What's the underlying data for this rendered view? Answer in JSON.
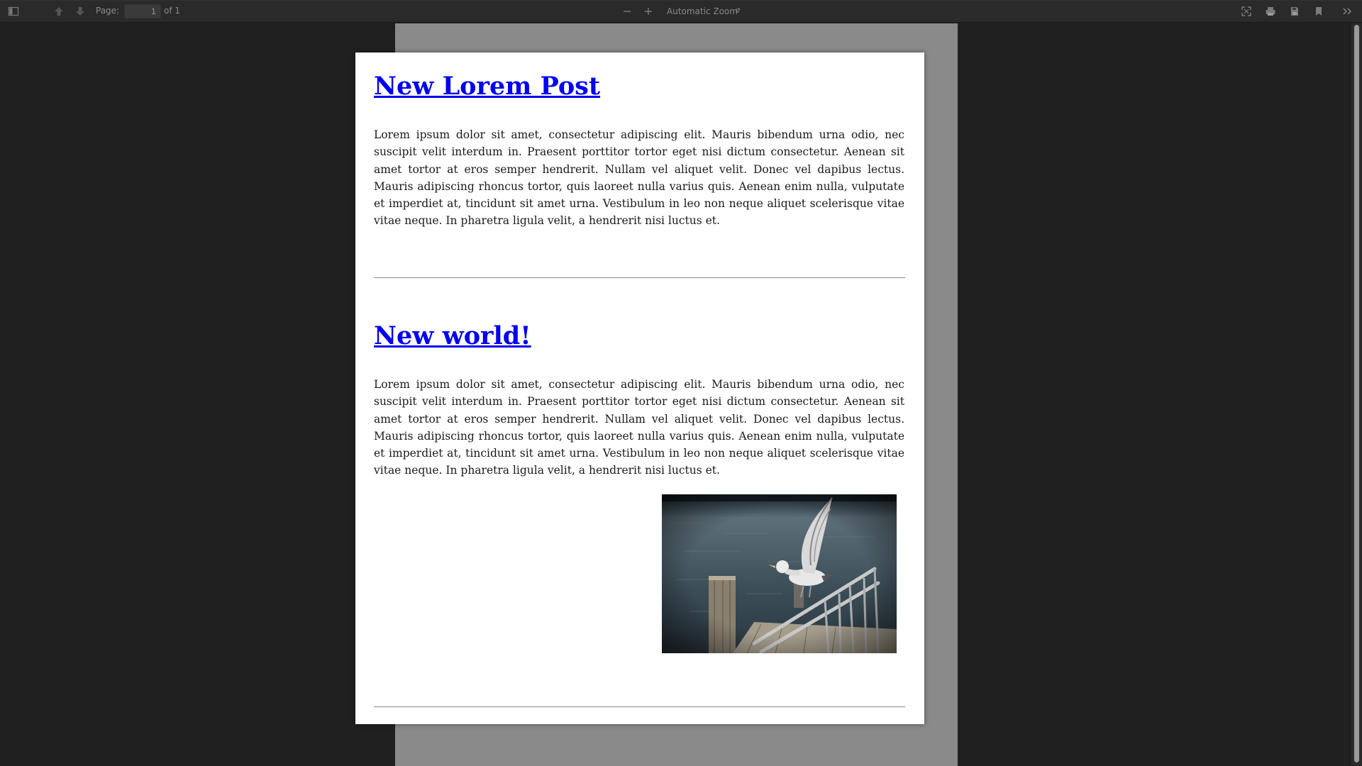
{
  "toolbar": {
    "page_label": "Page:",
    "page_value": "1",
    "page_of": "of 1",
    "zoom_label": "Automatic Zoom",
    "icons": [
      "sidebar-toggle-icon",
      "previous-page-icon",
      "next-page-icon",
      "zoom-out-icon",
      "zoom-in-icon",
      "presentation-mode-icon",
      "print-icon",
      "download-icon",
      "bookmark-icon",
      "tools-icon"
    ]
  },
  "posts": [
    {
      "title": "New Lorem Post",
      "body": "Lorem ipsum dolor sit amet, consectetur adipiscing elit. Mauris bibendum urna odio, nec suscipit velit interdum in. Praesent porttitor tortor eget nisi dictum consectetur. Aenean sit amet tortor at eros semper hendrerit. Nullam vel aliquet velit. Donec vel dapibus lectus. Mauris adipiscing rhoncus tortor, quis laoreet nulla varius quis. Aenean enim nulla, vulputate et imperdiet at, tincidunt sit amet urna. Vestibulum in leo non neque aliquet scelerisque vitae vitae neque. In pharetra ligula velit, a hendrerit nisi luctus et."
    },
    {
      "title": "New world!",
      "body": "Lorem ipsum dolor sit amet, consectetur adipiscing elit. Mauris bibendum urna odio, nec suscipit velit interdum in. Praesent porttitor tortor eget nisi dictum consectetur. Aenean sit amet tortor at eros semper hendrerit. Nullam vel aliquet velit. Donec vel dapibus lectus. Mauris adipiscing rhoncus tortor, quis laoreet nulla varius quis. Aenean enim nulla, vulputate et imperdiet at, tincidunt sit amet urna. Vestibulum in leo non neque aliquet scelerisque vitae vitae neque. In pharetra ligula velit, a hendrerit nisi luctus et."
    }
  ],
  "colors": {
    "link": "#0000ee",
    "toolbar_bg": "#2a2a2a",
    "viewer_bg": "#202020"
  }
}
